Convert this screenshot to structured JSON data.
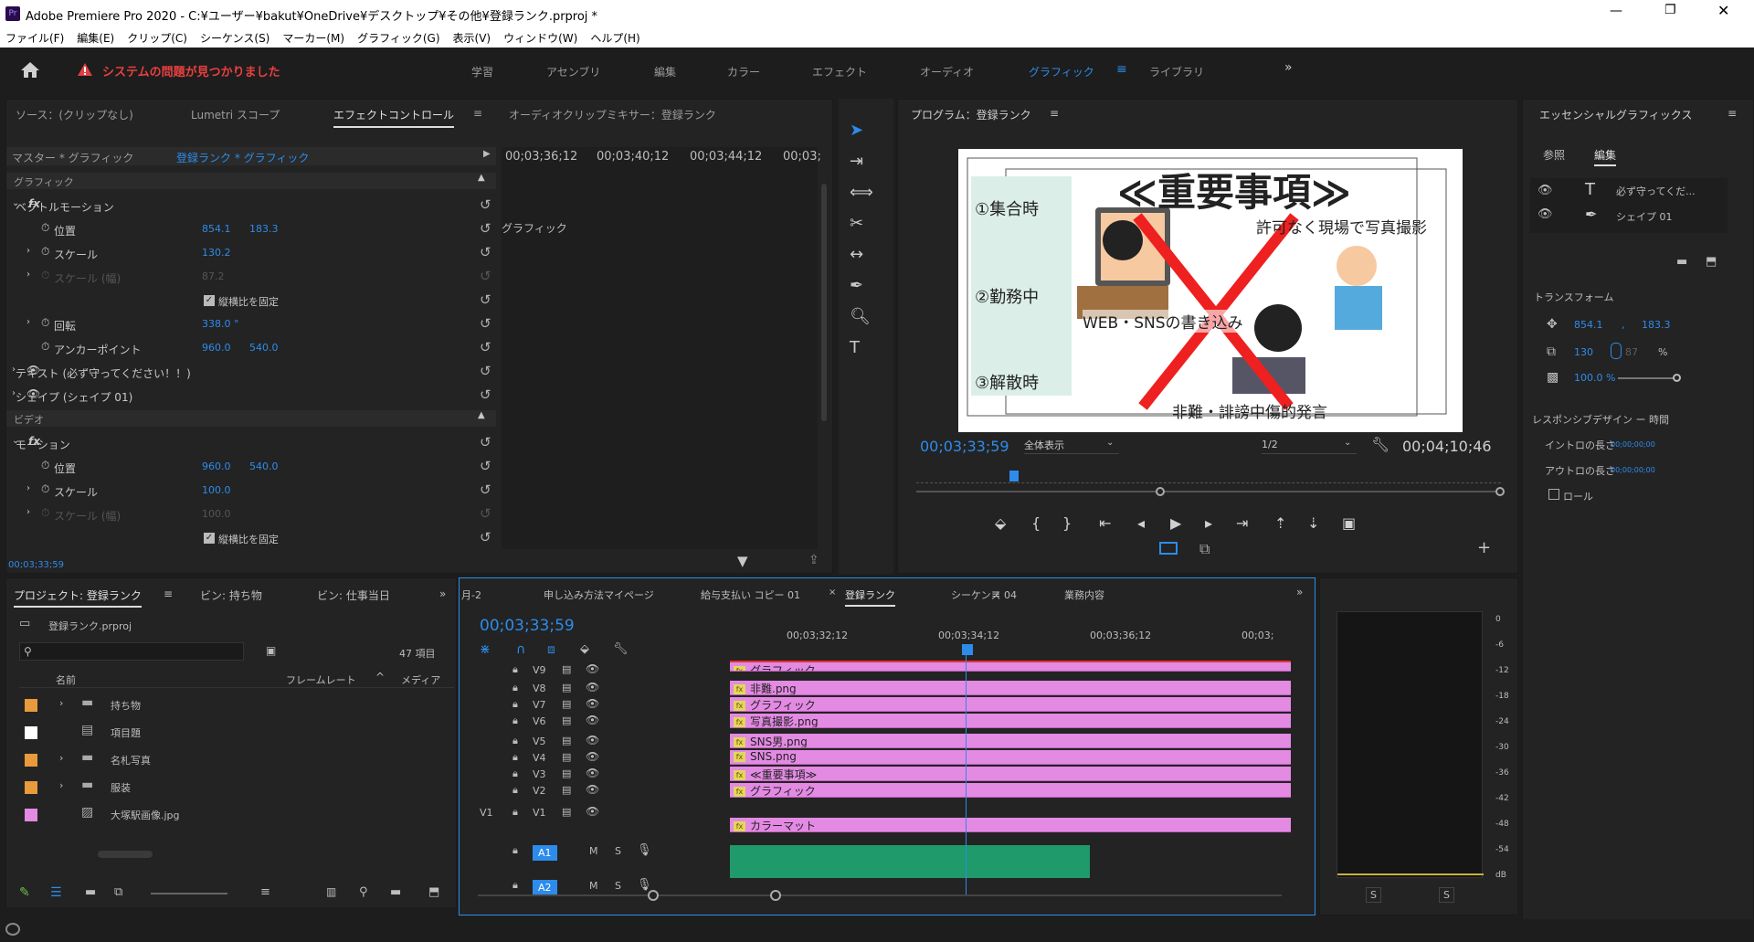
{
  "window": {
    "title": "Adobe Premiere Pro 2020 - C:¥ユーザー¥bakut¥OneDrive¥デスクトップ¥その他¥登録ランク.prproj *"
  },
  "menu": [
    "ファイル(F)",
    "編集(E)",
    "クリップ(C)",
    "シーケンス(S)",
    "マーカー(M)",
    "グラフィック(G)",
    "表示(V)",
    "ウィンドウ(W)",
    "ヘルプ(H)"
  ],
  "alert": "システムの問題が見つかりました",
  "workspaces": [
    "学習",
    "アセンブリ",
    "編集",
    "カラー",
    "エフェクト",
    "オーディオ",
    "グラフィック",
    "ライブラリ"
  ],
  "effect_panel": {
    "tabs": [
      "ソース：(クリップなし)",
      "Lumetri スコープ",
      "エフェクトコントロール",
      "オーディオクリップミキサー：登録ランク"
    ],
    "master": "マスター * グラフィック",
    "clip": "登録ランク * グラフィック",
    "ruler": [
      "00;03;36;12",
      "00;03;40;12",
      "00;03;44;12",
      "00;03;"
    ],
    "graphic_bar": "グラフィック",
    "section_graphic": "グラフィック",
    "vector_motion": "ベクトルモーション",
    "pos_label": "位置",
    "pos_x": "854.1",
    "pos_y": "183.3",
    "scale_label": "スケール",
    "scale": "130.2",
    "scale_w_label": "スケール (幅)",
    "scale_w": "87.2",
    "uniform": "縦横比を固定",
    "rotation_label": "回転",
    "rotation": "338.0 °",
    "anchor_label": "アンカーポイント",
    "anchor_x": "960.0",
    "anchor_y": "540.0",
    "text_layer": "テキスト (必ず守ってください！！)",
    "shape_layer": "シェイプ (シェイプ 01)",
    "section_video": "ビデオ",
    "motion": "モーション",
    "m_pos_x": "960.0",
    "m_pos_y": "540.0",
    "m_scale": "100.0",
    "m_scale_w": "100.0",
    "timecode": "00;03;33;59"
  },
  "program": {
    "title": "プログラム：登録ランク",
    "timecode": "00;03;33;59",
    "fit": "全体表示",
    "res": "1/2",
    "duration": "00;04;10;46",
    "frame": {
      "heading": "≪重要事項≫",
      "item1": "①集合時",
      "item2": "②勤務中",
      "item3": "③解散時",
      "permit": "許可なく現場で写真撮影",
      "web": "WEB・SNSの書き込み",
      "slander": "非難・誹謗中傷的発言"
    }
  },
  "essential": {
    "title": "エッセンシャルグラフィックス",
    "tab_browse": "参照",
    "tab_edit": "編集",
    "layer1": "必ず守ってくだ...",
    "layer2": "シェイプ 01",
    "transform": "トランスフォーム",
    "pos": "854.1",
    "pos2": "183.3",
    "scale": "130",
    "scale2": "87",
    "pct": "%",
    "opacity": "100.0 %",
    "responsive": "レスポンシブデザイン ー 時間",
    "intro": "イントロの長さ",
    "intro_val": "00;00;00;00",
    "outro": "アウトロの長さ",
    "outro_val": "00;00;00;00",
    "roll": "ロール"
  },
  "project": {
    "tabs": [
      "プロジェクト: 登録ランク",
      "ビン: 持ち物",
      "ビン: 仕事当日"
    ],
    "file": "登録ランク.prproj",
    "count": "47 項目",
    "cols": [
      "名前",
      "フレームレート",
      "メディア"
    ],
    "items": [
      {
        "name": "持ち物",
        "color": "#e89a3c"
      },
      {
        "name": "項目題",
        "color": "#ffffff"
      },
      {
        "name": "名札写真",
        "color": "#e89a3c"
      },
      {
        "name": "服装",
        "color": "#e89a3c"
      },
      {
        "name": "大塚駅画像.jpg",
        "color": "#e38ae3"
      }
    ]
  },
  "timeline": {
    "tabs": [
      "月-2",
      "申し込み方法マイページ",
      "給与支払い コピー 01",
      "登録ランク",
      "シーケンス 04",
      "業務内容"
    ],
    "timecode": "00;03;33;59",
    "ruler": [
      "00;03;32;12",
      "00;03;34;12",
      "00;03;36;12",
      "00;03;"
    ],
    "tracks": [
      "V9",
      "V8",
      "V7",
      "V6",
      "V5",
      "V4",
      "V3",
      "V2",
      "V1",
      "A1",
      "A2"
    ],
    "src": "V1",
    "m": "M",
    "s": "S",
    "clips": [
      "グラフィック",
      "非難.png",
      "グラフィック",
      "写真撮影.png",
      "SNS男.png",
      "SNS.png",
      "≪重要事項≫",
      "グラフィック",
      "カラーマット"
    ]
  },
  "meter": {
    "scale": [
      "0",
      "-6",
      "-12",
      "-18",
      "-24",
      "-30",
      "-36",
      "-42",
      "-48",
      "-54",
      "dB"
    ],
    "solo": "S"
  }
}
